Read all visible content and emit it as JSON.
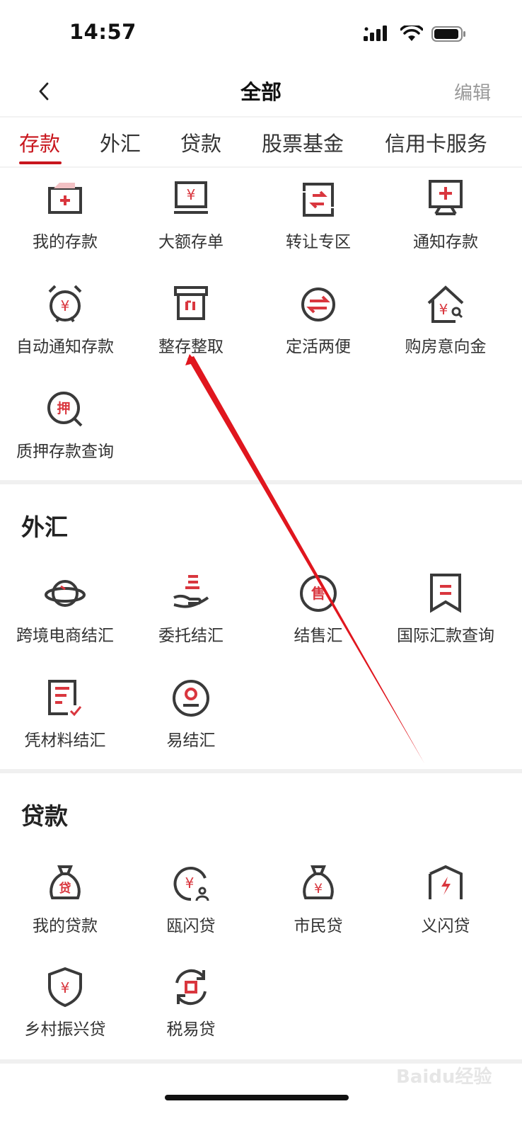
{
  "status": {
    "time": "14:57"
  },
  "nav": {
    "title": "全部",
    "edit_label": "编辑"
  },
  "tabs": [
    {
      "label": "存款",
      "active": true
    },
    {
      "label": "外汇",
      "active": false
    },
    {
      "label": "贷款",
      "active": false
    },
    {
      "label": "股票基金",
      "active": false
    },
    {
      "label": "信用卡服务",
      "active": false
    }
  ],
  "sections": {
    "deposit": {
      "items": [
        {
          "label": "我的存款",
          "icon": "card-plus-icon"
        },
        {
          "label": "大额存单",
          "icon": "monitor-yuan-icon"
        },
        {
          "label": "转让专区",
          "icon": "transfer-swap-icon"
        },
        {
          "label": "通知存款",
          "icon": "board-plus-icon"
        },
        {
          "label": "自动通知存款",
          "icon": "alarm-yuan-icon"
        },
        {
          "label": "整存整取",
          "icon": "box-icon"
        },
        {
          "label": "定活两便",
          "icon": "exchange-arrows-icon"
        },
        {
          "label": "购房意向金",
          "icon": "house-yuan-icon"
        },
        {
          "label": "质押存款查询",
          "icon": "pledge-search-icon"
        }
      ]
    },
    "forex": {
      "title": "外汇",
      "items": [
        {
          "label": "跨境电商结汇",
          "icon": "planet-icon"
        },
        {
          "label": "委托结汇",
          "icon": "hand-coins-icon"
        },
        {
          "label": "结售汇",
          "icon": "sell-circle-icon"
        },
        {
          "label": "国际汇款查询",
          "icon": "bookmark-icon"
        },
        {
          "label": "凭材料结汇",
          "icon": "document-check-icon"
        },
        {
          "label": "易结汇",
          "icon": "user-circle-icon"
        }
      ]
    },
    "loan": {
      "title": "贷款",
      "items": [
        {
          "label": "我的贷款",
          "icon": "money-bag-loan-icon"
        },
        {
          "label": "瓯闪贷",
          "icon": "yuan-user-icon"
        },
        {
          "label": "市民贷",
          "icon": "money-bag-yuan-icon"
        },
        {
          "label": "义闪贷",
          "icon": "house-lightning-icon"
        },
        {
          "label": "乡村振兴贷",
          "icon": "shield-yuan-icon"
        },
        {
          "label": "税易贷",
          "icon": "refresh-circle-icon"
        }
      ]
    }
  },
  "watermark": "Baidu经验",
  "colors": {
    "accent": "#c8161d",
    "icon_dark": "#3a3a3a",
    "icon_red": "#d9363e"
  }
}
